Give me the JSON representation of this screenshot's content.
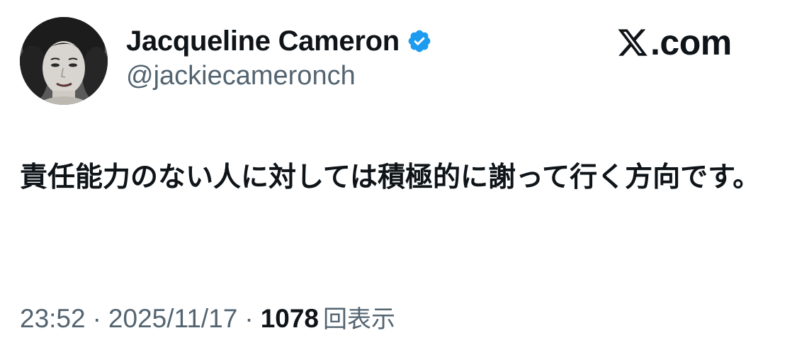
{
  "author": {
    "display_name": "Jacqueline Cameron",
    "handle": "@jackiecameronch",
    "verified": true,
    "avatar_icon": "portrait-photo"
  },
  "site": {
    "domain": ".com",
    "logo_icon": "x-logo-icon"
  },
  "tweet": {
    "text": "責任能力のない人に対しては積極的に謝って行く方向です。"
  },
  "meta": {
    "time": "23:52",
    "separator": "·",
    "date": "2025/11/17",
    "views_count": "1078",
    "views_label": "回表示"
  },
  "colors": {
    "text_primary": "#0f1419",
    "text_secondary": "#536471",
    "verified_blue": "#1d9bf0"
  }
}
